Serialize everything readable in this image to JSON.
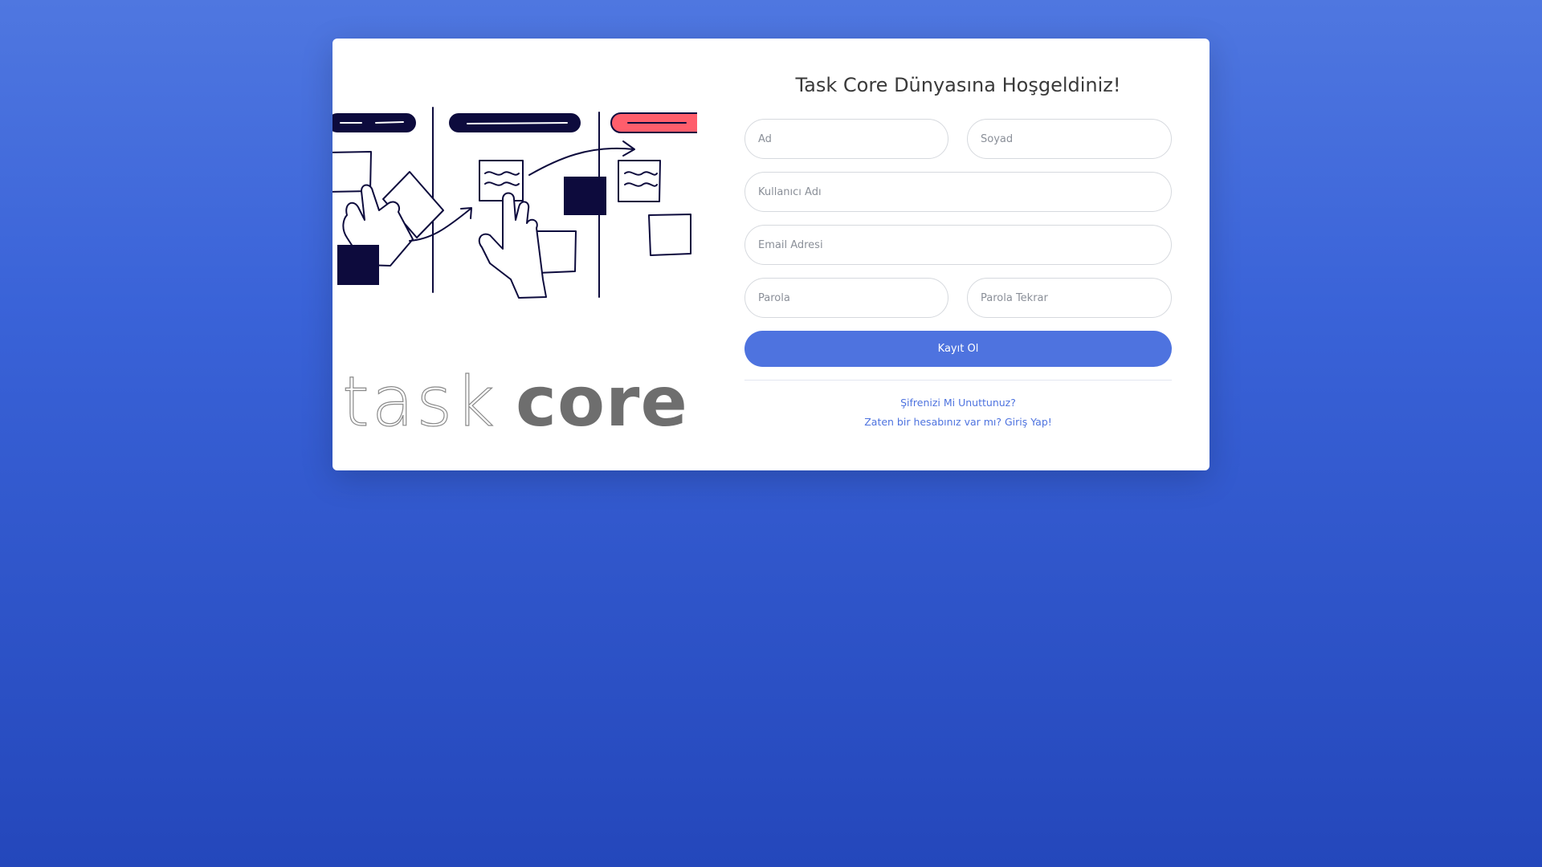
{
  "logo": {
    "text_outline": "task",
    "text_bold": "core"
  },
  "form": {
    "title": "Task Core Dünyasına Hoşgeldiniz!",
    "first_name_placeholder": "Ad",
    "last_name_placeholder": "Soyad",
    "username_placeholder": "Kullanıcı Adı",
    "email_placeholder": "Email Adresi",
    "password_placeholder": "Parola",
    "password_repeat_placeholder": "Parola Tekrar",
    "submit_label": "Kayıt Ol",
    "forgot_password_link": "Şifrenizi Mi Unuttunuz?",
    "login_link": "Zaten bir hesabınız var mı? Giriş Yap!"
  },
  "colors": {
    "accent": "#4e73df",
    "illustration_dark": "#0d0b3d",
    "illustration_red": "#ff5e6c",
    "logo_gray": "#6e6e6e"
  },
  "icons": {
    "kanban_illustration": "kanban-board-hands-illustration"
  }
}
